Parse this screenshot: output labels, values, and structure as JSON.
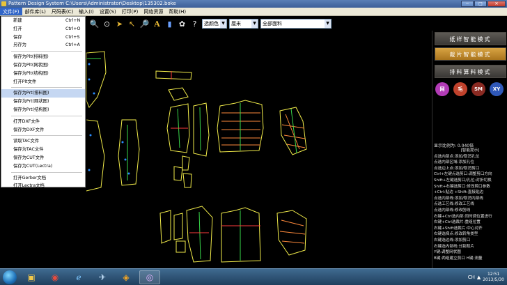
{
  "window": {
    "title": "Pattern Design System    C:\\Users\\Administrator\\Desktop\\135302.boke",
    "minimize": "─",
    "maximize": "□",
    "close": "✕"
  },
  "menubar": [
    "文件(F)",
    "部件库(L)",
    "尺码表(C)",
    "输入(I)",
    "设置(S)",
    "打印(P)",
    "网络资源",
    "帮助(H)"
  ],
  "file_menu": {
    "groups": [
      [
        {
          "label": "新建",
          "shortcut": "Ctrl+N"
        },
        {
          "label": "打开",
          "shortcut": "Ctrl+O"
        },
        {
          "label": "保存",
          "shortcut": "Ctrl+S"
        },
        {
          "label": "另存为",
          "shortcut": "Ctrl+A"
        }
      ],
      [
        {
          "label": "保存为Plt(排料图)",
          "shortcut": ""
        },
        {
          "label": "保存为Plt(网状图)",
          "shortcut": ""
        },
        {
          "label": "保存为Plt(结构图)",
          "shortcut": ""
        },
        {
          "label": "打开Plt文件",
          "shortcut": ""
        }
      ],
      [
        {
          "label": "保存为Prt(排料图)",
          "shortcut": "",
          "highlight": true
        },
        {
          "label": "保存为Prt(网状图)",
          "shortcut": ""
        },
        {
          "label": "保存为Prt(结构图)",
          "shortcut": ""
        }
      ],
      [
        {
          "label": "打开DXF文件",
          "shortcut": ""
        },
        {
          "label": "保存为DXF文件",
          "shortcut": ""
        }
      ],
      [
        {
          "label": "读取TAC文件",
          "shortcut": ""
        },
        {
          "label": "保存为TAC文件",
          "shortcut": ""
        },
        {
          "label": "保存为CUT文件",
          "shortcut": ""
        },
        {
          "label": "保存为CUT(Lectra)",
          "shortcut": ""
        }
      ],
      [
        {
          "label": "打开Gerber文档",
          "shortcut": ""
        },
        {
          "label": "打开Lectra文档",
          "shortcut": ""
        }
      ]
    ]
  },
  "toolbar": {
    "icons": [
      "zoom-icon",
      "zoom-fit-icon",
      "arrow-icon",
      "rotate-arrow-icon",
      "magnify-icon",
      "text-icon",
      "figure-icon",
      "pattern-icon",
      "help-icon"
    ],
    "select_color": "选颜色",
    "select_unit": "厘米",
    "select_fabric": "全部面料"
  },
  "right_panel": {
    "modes": [
      "纸样智能模式",
      "裁片智能模式",
      "排料算料模式"
    ],
    "active_mode_index": 1,
    "circle_buttons": [
      {
        "label": "网",
        "color": "#b23bb6"
      },
      {
        "label": "毛",
        "color": "#c0422c"
      },
      {
        "label": "SM",
        "color": "#8a2a22"
      },
      {
        "label": "XY",
        "color": "#2f58b8"
      }
    ],
    "ratio": "显示比例为: 0.040倍",
    "help_title": "[智能提示]",
    "help_lines": [
      "点选内部点:添加/取消孔位",
      "点选内部区域:添加孔位",
      "点选边上点:添加/取消剪口",
      "Ctrl+左键点选剪口:调整剪口方向",
      "Shift+左键选剪口/孔位:对折切换",
      "Shift+右键选剪口:修改剪口参数",
      "+Ctrl:贴边 +Shift:直接贴边",
      "点选内部线:添加/取消内部线",
      "点选工艺线:修改工艺线",
      "点选内部线:修改刨线",
      "右键+Ctrl选内部:同时调位置进行",
      "右键+Ctrl选裁片:重组位置",
      "右键+Shift选裁片:中心对齐",
      "右键选择点:修改转角类型",
      "右键选边线:添加剪口",
      "右键选内部线:分割裁片",
      "Y键:调整网状图",
      "B键:两组建立剪口  H键:测量"
    ]
  },
  "taskbar": {
    "apps": [
      "explorer-icon",
      "chrome-icon",
      "ie-icon",
      "plane-icon",
      "media-icon",
      "pattern-app-icon",
      "qq-icon"
    ],
    "tray": [
      "CH",
      "▲"
    ],
    "time": "12:51",
    "date": "2013/5/30"
  },
  "colors": {
    "pattern_outline": "#f2ec4a",
    "seam": "#ffffff",
    "grain": "#39d84a",
    "notch": "#ff3b3b",
    "point": "#2a8cff"
  }
}
